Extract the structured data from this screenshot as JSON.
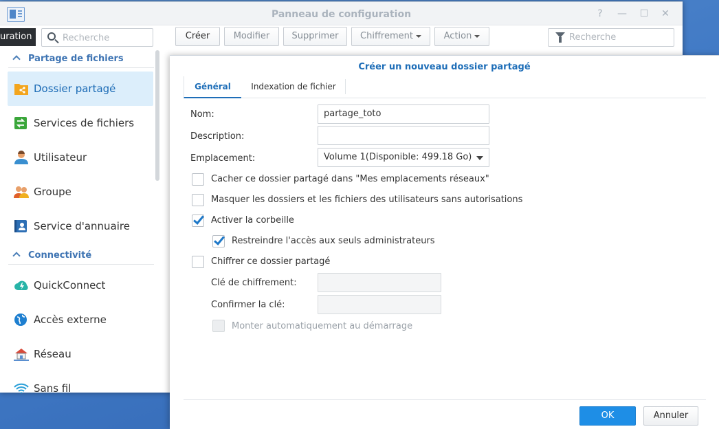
{
  "window": {
    "title": "Panneau de configuration",
    "tooltip": "uration",
    "help_glyph": "?",
    "minimize_glyph": "—",
    "maximize_glyph": "☐",
    "close_glyph": "✕"
  },
  "sidebar": {
    "search_placeholder": "Recherche",
    "sections": [
      {
        "label": "Partage de fichiers"
      },
      {
        "label": "Connectivité"
      }
    ],
    "items": [
      {
        "label": "Dossier partagé",
        "icon": "shared-folder-icon",
        "active": true
      },
      {
        "label": "Services de fichiers",
        "icon": "file-services-icon"
      },
      {
        "label": "Utilisateur",
        "icon": "user-icon"
      },
      {
        "label": "Groupe",
        "icon": "group-icon"
      },
      {
        "label": "Service d'annuaire",
        "icon": "directory-service-icon"
      },
      {
        "label": "QuickConnect",
        "icon": "quickconnect-icon"
      },
      {
        "label": "Accès externe",
        "icon": "external-access-icon"
      },
      {
        "label": "Réseau",
        "icon": "network-icon"
      },
      {
        "label": "Sans fil",
        "icon": "wifi-icon"
      }
    ]
  },
  "toolbar": {
    "create": "Créer",
    "modify": "Modifier",
    "delete": "Supprimer",
    "encryption": "Chiffrement",
    "action": "Action",
    "filter_placeholder": "Recherche"
  },
  "dialog": {
    "title": "Créer un nouveau dossier partagé",
    "tabs": [
      "Général",
      "Indexation de fichier"
    ],
    "fields": {
      "name_label": "Nom:",
      "name_value": "partage_toto",
      "description_label": "Description:",
      "description_value": "",
      "location_label": "Emplacement:",
      "location_value": "Volume 1(Disponible: 499.18 Go)"
    },
    "checkboxes": {
      "hide_network": "Cacher ce dossier partagé dans \"Mes emplacements réseaux\"",
      "hide_unauthorized": "Masquer les dossiers et les fichiers des utilisateurs sans autorisations",
      "recycle_bin": "Activer la corbeille",
      "admin_only": "Restreindre l'accès aux seuls administrateurs",
      "encrypt": "Chiffrer ce dossier partagé",
      "auto_mount": "Monter automatiquement au démarrage"
    },
    "encryption": {
      "key_label": "Clé de chiffrement:",
      "confirm_label": "Confirmer la clé:"
    },
    "buttons": {
      "ok": "OK",
      "cancel": "Annuler"
    }
  },
  "colors": {
    "accent": "#1e6eb8",
    "primary_button": "#1e8ee6",
    "active_sidebar": "#dceefb",
    "desktop": "#3f78c4"
  }
}
